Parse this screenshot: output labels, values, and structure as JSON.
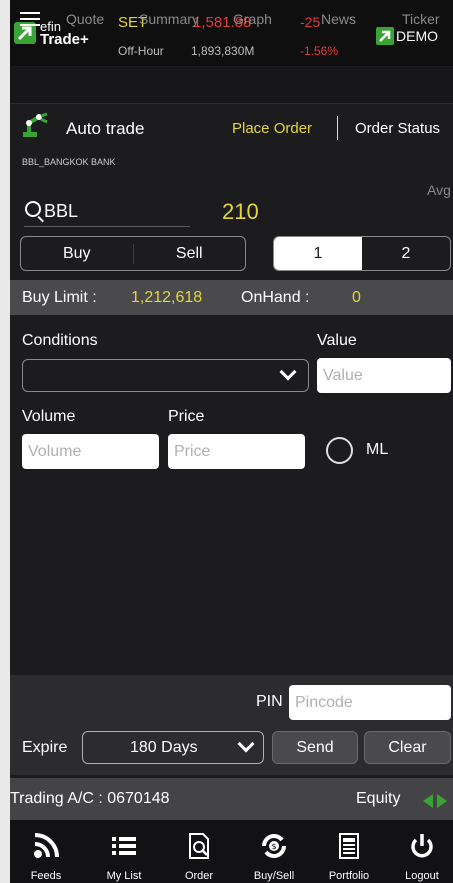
{
  "header": {
    "logo_top": "efin",
    "logo_bottom": "Trade+",
    "index_name": "SET",
    "index_value": "1,581.88",
    "index_change": "-25",
    "market_status": "Off-Hour",
    "market_volume": "1,893,830M",
    "index_change_pct": "-1.56%",
    "demo_label": "DEMO"
  },
  "nav": {
    "tabs": [
      "Quote",
      "Summary",
      "Graph",
      "News",
      "Ticker"
    ]
  },
  "subbar": {
    "title": "Auto trade",
    "place_order": "Place Order",
    "order_status": "Order Status"
  },
  "stock": {
    "full_name": "BBL_BANGKOK BANK",
    "avg_label": "Avg",
    "symbol": "BBL",
    "last_price": "210"
  },
  "side_toggle": {
    "buy": "Buy",
    "sell": "Sell"
  },
  "page_toggle": {
    "one": "1",
    "two": "2",
    "selected": "1"
  },
  "limits": {
    "buy_limit_label": "Buy Limit :",
    "buy_limit_value": "1,212,618",
    "onhand_label": "OnHand :",
    "onhand_value": "0"
  },
  "form": {
    "conditions_label": "Conditions",
    "value_label": "Value",
    "value_placeholder": "Value",
    "volume_label": "Volume",
    "volume_placeholder": "Volume",
    "price_label": "Price",
    "price_placeholder": "Price",
    "ml_label": "ML"
  },
  "submit": {
    "pin_label": "PIN",
    "pin_placeholder": "Pincode",
    "expire_label": "Expire",
    "expire_value": "180 Days",
    "send": "Send",
    "clear": "Clear"
  },
  "account": {
    "label": "Trading A/C : 0670148",
    "type": "Equity"
  },
  "tabbar": {
    "items": [
      "Feeds",
      "My List",
      "Order",
      "Buy/Sell",
      "Portfolio",
      "Logout"
    ]
  },
  "colors": {
    "accent_yellow": "#e4d63a",
    "negative_red": "#e23b3b",
    "brand_green": "#3aa335",
    "background": "#1c1c1e"
  }
}
